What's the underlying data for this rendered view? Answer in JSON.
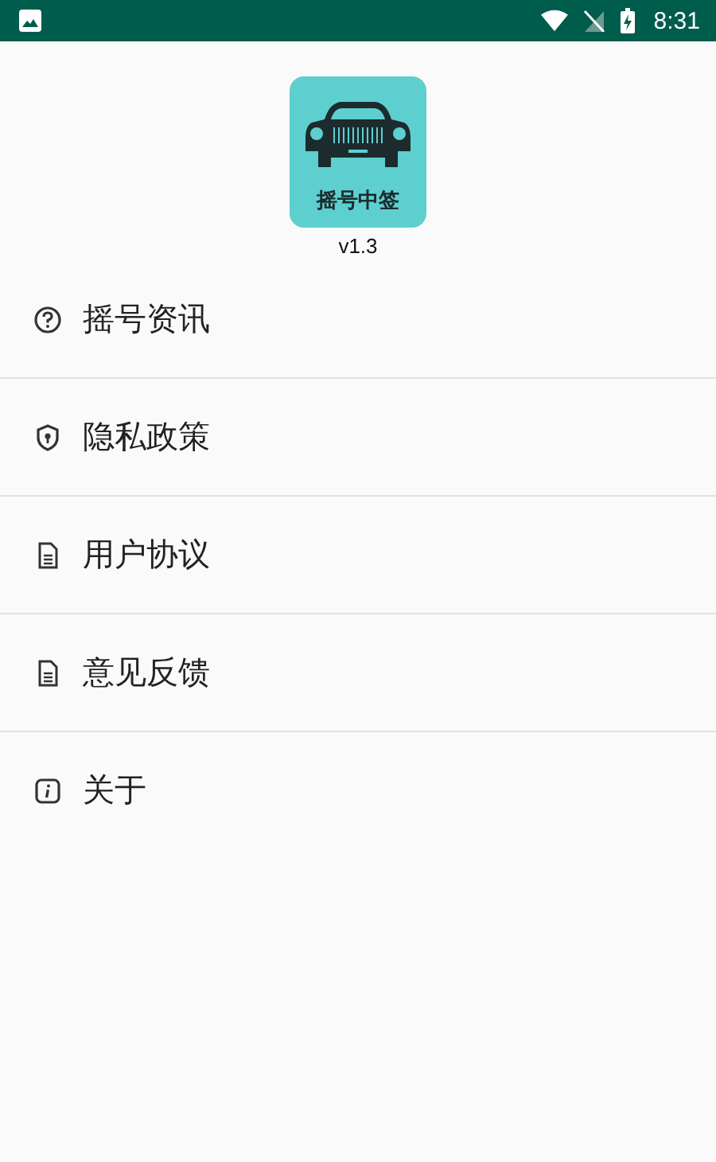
{
  "status_bar": {
    "time": "8:31"
  },
  "app": {
    "logo_text": "摇号中签",
    "version": "v1.3"
  },
  "menu": [
    {
      "label": "摇号资讯",
      "kind": "question"
    },
    {
      "label": "隐私政策",
      "kind": "shield"
    },
    {
      "label": "用户协议",
      "kind": "document"
    },
    {
      "label": "意见反馈",
      "kind": "document"
    },
    {
      "label": "关于",
      "kind": "info"
    }
  ]
}
